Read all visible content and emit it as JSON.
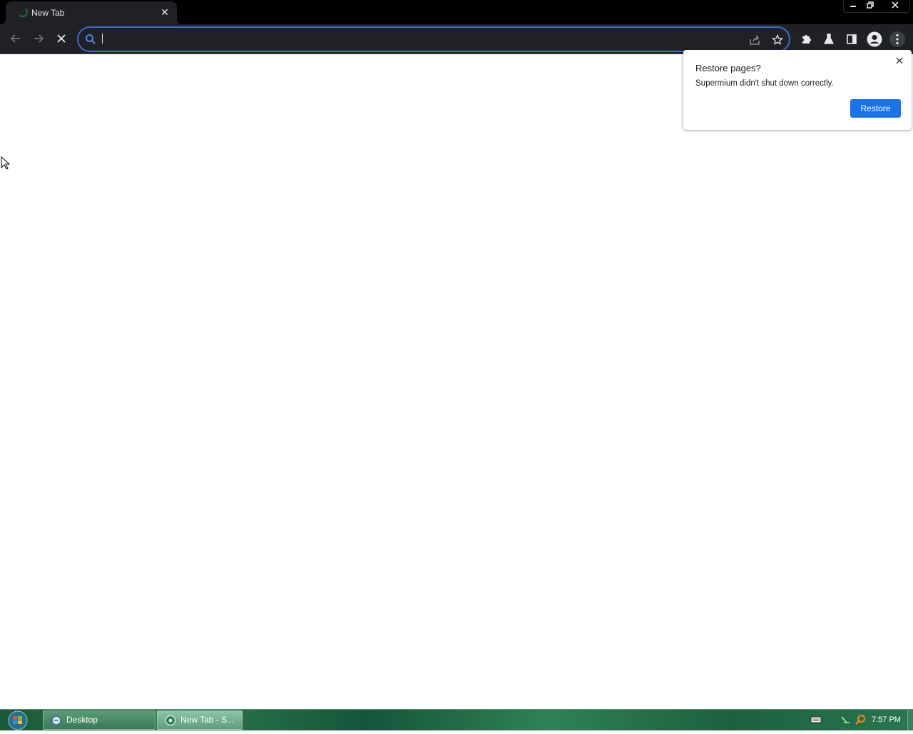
{
  "browser": {
    "tab": {
      "title": "New Tab",
      "close_glyph": "✕",
      "icon": "loading-spinner"
    },
    "window_controls": {
      "minimize": "—",
      "maximize": "❐",
      "close": "✕"
    },
    "omnibox": {
      "value": "",
      "placeholder": ""
    },
    "accent_color": "#3b6fd4"
  },
  "restore_bubble": {
    "title": "Restore pages?",
    "message": "Supermium didn't shut down correctly.",
    "restore_label": "Restore",
    "button_color": "#1a73e8"
  },
  "taskbar": {
    "buttons": [
      {
        "label": "Desktop",
        "icon": "desktop-icon"
      },
      {
        "label": "New Tab - S...",
        "icon": "browser-icon"
      }
    ],
    "clock": "7:57 PM",
    "tray_icons": [
      "keyboard-icon",
      "network-icon",
      "search-icon"
    ]
  }
}
